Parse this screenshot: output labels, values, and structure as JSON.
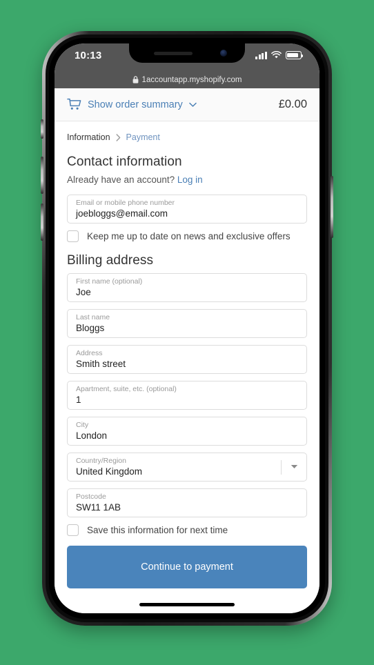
{
  "status_bar": {
    "time": "10:13",
    "signal_icon": "signal-bars-icon",
    "wifi_icon": "wifi-icon",
    "battery_icon": "battery-icon"
  },
  "browser": {
    "lock_icon": "lock-icon",
    "url": "1accountapp.myshopify.com"
  },
  "order_summary": {
    "cart_icon": "shopping-cart-icon",
    "label": "Show order summary",
    "chevron_icon": "chevron-down-icon",
    "total": "£0.00"
  },
  "breadcrumb": {
    "current": "Information",
    "separator_icon": "chevron-right-icon",
    "next": "Payment"
  },
  "contact": {
    "heading": "Contact information",
    "account_prompt": "Already have an account?",
    "login_link": "Log in",
    "email_field": {
      "label": "Email or mobile phone number",
      "value": "joebloggs@email.com"
    },
    "news_checkbox_label": "Keep me up to date on news and exclusive offers",
    "news_checkbox_checked": false
  },
  "billing": {
    "heading": "Billing address",
    "fields": [
      {
        "label": "First name (optional)",
        "value": "Joe",
        "type": "text"
      },
      {
        "label": "Last name",
        "value": "Bloggs",
        "type": "text"
      },
      {
        "label": "Address",
        "value": "Smith street",
        "type": "text"
      },
      {
        "label": "Apartment, suite, etc. (optional)",
        "value": "1",
        "type": "text"
      },
      {
        "label": "City",
        "value": "London",
        "type": "text"
      },
      {
        "label": "Country/Region",
        "value": "United Kingdom",
        "type": "select"
      },
      {
        "label": "Postcode",
        "value": "SW11 1AB",
        "type": "text"
      }
    ],
    "save_checkbox_label": "Save this information for next time",
    "save_checkbox_checked": false
  },
  "cta": {
    "label": "Continue to payment"
  },
  "colors": {
    "background": "#3CA86B",
    "accent_blue": "#4a84bb",
    "link_blue": "#4a7fb5",
    "status_bar": "#555555"
  }
}
